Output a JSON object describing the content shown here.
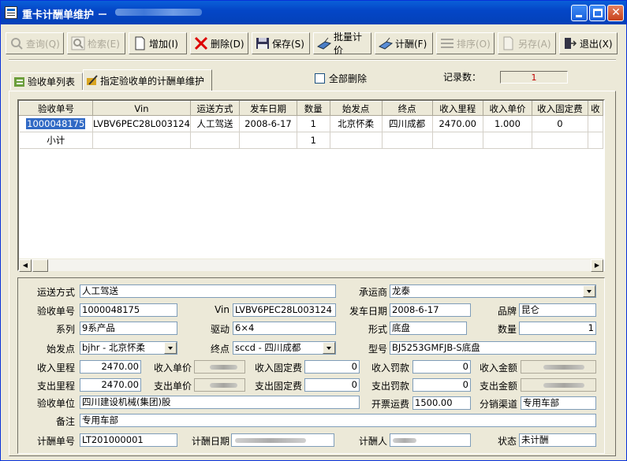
{
  "window": {
    "title": "重卡计酬单维护 －"
  },
  "toolbar": {
    "buttons": [
      {
        "label": "查询(Q)",
        "icon": "search-icon",
        "enabled": false
      },
      {
        "label": "检索(E)",
        "icon": "magnifier-icon",
        "enabled": false
      },
      {
        "label": "增加(I)",
        "icon": "new-document-icon",
        "enabled": true
      },
      {
        "label": "删除(D)",
        "icon": "delete-x-icon",
        "enabled": true
      },
      {
        "label": "保存(S)",
        "icon": "save-icon",
        "enabled": true
      },
      {
        "label": "批量计价",
        "icon": "batch-price-icon",
        "enabled": true
      },
      {
        "label": "计酬(F)",
        "icon": "compute-icon",
        "enabled": true
      },
      {
        "label": "排序(O)",
        "icon": "sort-icon",
        "enabled": false
      },
      {
        "label": "另存(A)",
        "icon": "save-as-icon",
        "enabled": false
      },
      {
        "label": "退出(X)",
        "icon": "exit-icon",
        "enabled": true
      }
    ]
  },
  "tabs": [
    {
      "label": "验收单列表",
      "icon": "list-icon",
      "active": false
    },
    {
      "label": "指定验收单的计酬单维护",
      "icon": "edit-pencil-icon",
      "active": true
    }
  ],
  "delete_all": {
    "label": "全部删除",
    "checked": false
  },
  "record_count": {
    "label": "记录数：",
    "value": "1"
  },
  "grid": {
    "columns": [
      "验收单号",
      "Vin",
      "运送方式",
      "发车日期",
      "数量",
      "始发点",
      "终点",
      "收入里程",
      "收入单价",
      "收入固定费",
      "收"
    ],
    "rows": [
      [
        "1000048175",
        "LVBV6PEC28L003124",
        "人工驾送",
        "2008-6-17",
        "1",
        "北京怀柔",
        "四川成都",
        "2470.00",
        "1.000",
        "0",
        ""
      ],
      [
        "小计",
        "",
        "",
        "",
        "1",
        "",
        "",
        "",
        "",
        "",
        ""
      ]
    ]
  },
  "form": {
    "transport_mode": {
      "label": "运送方式",
      "value": "人工驾送"
    },
    "carrier": {
      "label": "承运商",
      "value": "龙泰"
    },
    "receipt_no": {
      "label": "验收单号",
      "value": "1000048175"
    },
    "vin": {
      "label": "Vin",
      "value": "LVBV6PEC28L003124"
    },
    "depart_date": {
      "label": "发车日期",
      "value": "2008-6-17"
    },
    "brand": {
      "label": "品牌",
      "value": "昆仑"
    },
    "series": {
      "label": "系列",
      "value": "9系产品"
    },
    "drive": {
      "label": "驱动",
      "value": "6×4"
    },
    "form_type": {
      "label": "形式",
      "value": "底盘"
    },
    "quantity": {
      "label": "数量",
      "value": "1"
    },
    "origin": {
      "label": "始发点",
      "value": "bjhr - 北京怀柔"
    },
    "destination": {
      "label": "终点",
      "value": "sccd - 四川成都"
    },
    "model": {
      "label": "型号",
      "value": "BJ5253GMFJB-S底盘"
    },
    "income_mileage": {
      "label": "收入里程",
      "value": "2470.00"
    },
    "income_unit_price": {
      "label": "收入单价",
      "value": ""
    },
    "income_fixed_fee": {
      "label": "收入固定费",
      "value": "0"
    },
    "income_penalty": {
      "label": "收入罚款",
      "value": "0"
    },
    "income_amount": {
      "label": "收入金额",
      "value": ""
    },
    "expense_mileage": {
      "label": "支出里程",
      "value": "2470.00"
    },
    "expense_unit_price": {
      "label": "支出单价",
      "value": ""
    },
    "expense_fixed_fee": {
      "label": "支出固定费",
      "value": "0"
    },
    "expense_penalty": {
      "label": "支出罚款",
      "value": "0"
    },
    "expense_amount": {
      "label": "支出金额",
      "value": ""
    },
    "receipt_unit": {
      "label": "验收单位",
      "value": "四川建设机械(集团)股"
    },
    "invoice_fee": {
      "label": "开票运费",
      "value": "1500.00"
    },
    "channel": {
      "label": "分销渠道",
      "value": "专用车部"
    },
    "remark": {
      "label": "备注",
      "value": "专用车部"
    },
    "pay_no": {
      "label": "计酬单号",
      "value": "LT201000001"
    },
    "pay_date": {
      "label": "计酬日期",
      "value": ""
    },
    "payer": {
      "label": "计酬人",
      "value": ""
    },
    "status": {
      "label": "状态",
      "value": "未计酬"
    }
  }
}
